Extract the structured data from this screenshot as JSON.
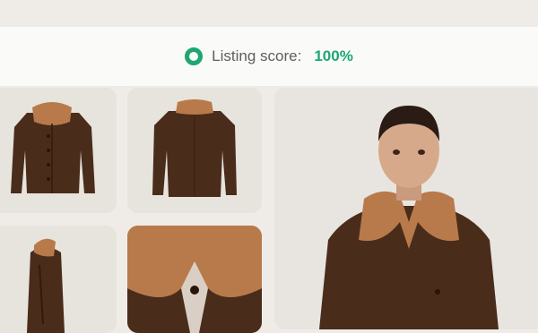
{
  "listing": {
    "label": "Listing score:",
    "value": "100%"
  },
  "colors": {
    "accent": "#1fa673",
    "jacket": "#4a2c1b",
    "fur": "#b87a4a"
  },
  "gallery": {
    "images": [
      {
        "name": "jacket-front-image"
      },
      {
        "name": "jacket-back-image"
      },
      {
        "name": "jacket-side-image"
      },
      {
        "name": "jacket-collar-closeup-image"
      },
      {
        "name": "model-wearing-jacket-image"
      }
    ]
  }
}
